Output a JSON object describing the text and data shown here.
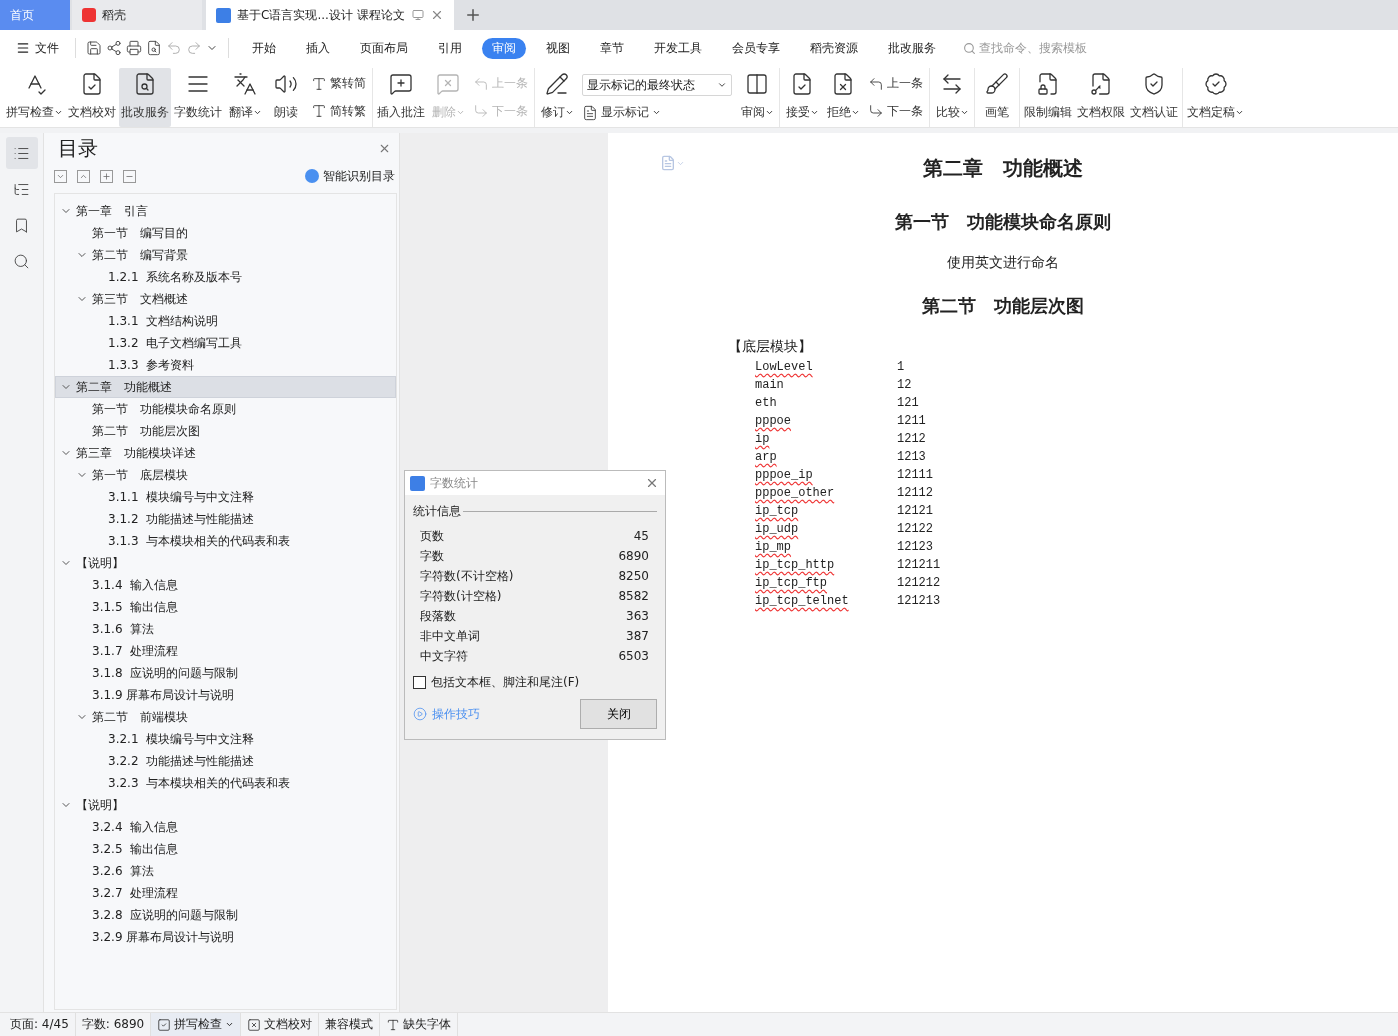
{
  "tabs": [
    {
      "label": "首页",
      "kind": "home",
      "selected": false
    },
    {
      "label": "稻壳",
      "kind": "app",
      "selected": false
    },
    {
      "label": "基于C语言实现...设计 课程论文",
      "kind": "doc",
      "selected": true
    }
  ],
  "menu": {
    "file_label": "文件",
    "tabs": [
      {
        "label": "开始",
        "selected": false
      },
      {
        "label": "插入",
        "selected": false
      },
      {
        "label": "页面布局",
        "selected": false
      },
      {
        "label": "引用",
        "selected": false
      },
      {
        "label": "审阅",
        "selected": true
      },
      {
        "label": "视图",
        "selected": false
      },
      {
        "label": "章节",
        "selected": false
      },
      {
        "label": "开发工具",
        "selected": false
      },
      {
        "label": "会员专享",
        "selected": false
      },
      {
        "label": "稻壳资源",
        "selected": false
      },
      {
        "label": "批改服务",
        "selected": false
      }
    ],
    "search_placeholder": "查找命令、搜索模板"
  },
  "ribbon": [
    {
      "items": [
        {
          "kind": "big",
          "label": "拼写检查",
          "dropdown": true,
          "disabled": false,
          "selected": false
        },
        {
          "kind": "big",
          "label": "文档校对",
          "dropdown": false,
          "disabled": false,
          "selected": false
        },
        {
          "kind": "big",
          "label": "批改服务",
          "dropdown": false,
          "disabled": false,
          "selected": true
        },
        {
          "kind": "big",
          "label": "字数统计",
          "dropdown": false,
          "disabled": false,
          "selected": false
        },
        {
          "kind": "big",
          "label": "翻译",
          "dropdown": true,
          "disabled": false,
          "selected": false
        },
        {
          "kind": "big",
          "label": "朗读",
          "dropdown": false,
          "disabled": false,
          "selected": false
        },
        {
          "kind": "stack",
          "items": [
            {
              "kind": "small",
              "label": "繁转简",
              "dropdown": false,
              "disabled": false
            },
            {
              "kind": "small",
              "label": "简转繁",
              "dropdown": false,
              "disabled": false
            }
          ]
        }
      ]
    },
    {
      "items": [
        {
          "kind": "big",
          "label": "插入批注",
          "dropdown": false,
          "disabled": false,
          "selected": false
        },
        {
          "kind": "big",
          "label": "删除",
          "dropdown": true,
          "disabled": true,
          "selected": false
        },
        {
          "kind": "stack",
          "items": [
            {
              "kind": "small",
              "label": "上一条",
              "dropdown": false,
              "disabled": true
            },
            {
              "kind": "small",
              "label": "下一条",
              "dropdown": false,
              "disabled": true
            }
          ]
        }
      ]
    },
    {
      "items": [
        {
          "kind": "big",
          "label": "修订",
          "dropdown": true,
          "disabled": false,
          "selected": false
        },
        {
          "kind": "stack",
          "items": [
            {
              "kind": "select",
              "value": "显示标记的最终状态"
            },
            {
              "kind": "small",
              "label": "显示标记",
              "dropdown": true,
              "disabled": false
            }
          ]
        },
        {
          "kind": "big",
          "label": "审阅",
          "dropdown": true,
          "disabled": false,
          "selected": false
        }
      ]
    },
    {
      "items": [
        {
          "kind": "big",
          "label": "接受",
          "dropdown": true,
          "disabled": false,
          "selected": false
        },
        {
          "kind": "big",
          "label": "拒绝",
          "dropdown": true,
          "disabled": false,
          "selected": false
        },
        {
          "kind": "stack",
          "items": [
            {
              "kind": "small",
              "label": "上一条",
              "dropdown": false,
              "disabled": false
            },
            {
              "kind": "small",
              "label": "下一条",
              "dropdown": false,
              "disabled": false
            }
          ]
        }
      ]
    },
    {
      "items": [
        {
          "kind": "big",
          "label": "比较",
          "dropdown": true,
          "disabled": false,
          "selected": false
        }
      ]
    },
    {
      "items": [
        {
          "kind": "big",
          "label": "画笔",
          "dropdown": false,
          "disabled": false,
          "selected": false
        }
      ]
    },
    {
      "items": [
        {
          "kind": "big",
          "label": "限制编辑",
          "dropdown": false,
          "disabled": false,
          "selected": false
        },
        {
          "kind": "big",
          "label": "文档权限",
          "dropdown": false,
          "disabled": false,
          "selected": false
        },
        {
          "kind": "big",
          "label": "文档认证",
          "dropdown": false,
          "disabled": false,
          "selected": false
        }
      ]
    },
    {
      "items": [
        {
          "kind": "big",
          "label": "文档定稿",
          "dropdown": true,
          "disabled": false,
          "selected": false
        }
      ]
    }
  ],
  "rail": [
    {
      "selected": true
    },
    {
      "selected": false
    },
    {
      "selected": false
    },
    {
      "selected": false
    }
  ],
  "toc": {
    "title": "目录",
    "smart_label": "智能识别目录",
    "items": [
      {
        "label": "第一章　引言",
        "expanded": true,
        "selected": false,
        "children": [
          {
            "label": "第一节　编写目的",
            "selected": false
          },
          {
            "label": "第二节　编写背景",
            "expanded": true,
            "selected": false,
            "children": [
              {
                "label": "1.2.1  系统名称及版本号",
                "selected": false
              }
            ]
          },
          {
            "label": "第三节　文档概述",
            "expanded": true,
            "selected": false,
            "children": [
              {
                "label": "1.3.1  文档结构说明",
                "selected": false
              },
              {
                "label": "1.3.2  电子文档编写工具",
                "selected": false
              },
              {
                "label": "1.3.3  参考资料",
                "selected": false
              }
            ]
          }
        ]
      },
      {
        "label": "第二章　功能概述",
        "expanded": true,
        "selected": true,
        "children": [
          {
            "label": "第一节　功能模块命名原则",
            "selected": false
          },
          {
            "label": "第二节　功能层次图",
            "selected": false
          }
        ]
      },
      {
        "label": "第三章　功能模块详述",
        "expanded": true,
        "selected": false,
        "children": [
          {
            "label": "第一节　底层模块",
            "expanded": true,
            "selected": false,
            "children": [
              {
                "label": "3.1.1  模块编号与中文注释",
                "selected": false
              },
              {
                "label": "3.1.2  功能描述与性能描述",
                "selected": false
              },
              {
                "label": "3.1.3  与本模块相关的代码表和表",
                "selected": false
              }
            ]
          }
        ]
      },
      {
        "label": "【说明】",
        "expanded": true,
        "selected": false,
        "children": [
          {
            "label": "3.1.4  输入信息",
            "selected": false
          },
          {
            "label": "3.1.5  输出信息",
            "selected": false
          },
          {
            "label": "3.1.6  算法",
            "selected": false
          },
          {
            "label": "3.1.7  处理流程",
            "selected": false
          },
          {
            "label": "3.1.8  应说明的问题与限制",
            "selected": false
          },
          {
            "label": "3.1.9 屏幕布局设计与说明",
            "selected": false
          },
          {
            "label": "第二节　前端模块",
            "expanded": true,
            "selected": false,
            "children": [
              {
                "label": "3.2.1  模块编号与中文注释",
                "selected": false
              },
              {
                "label": "3.2.2  功能描述与性能描述",
                "selected": false
              },
              {
                "label": "3.2.3  与本模块相关的代码表和表",
                "selected": false
              }
            ]
          }
        ]
      },
      {
        "label": "【说明】",
        "expanded": true,
        "selected": false,
        "children": [
          {
            "label": "3.2.4  输入信息",
            "selected": false
          },
          {
            "label": "3.2.5  输出信息",
            "selected": false
          },
          {
            "label": "3.2.6  算法",
            "selected": false
          },
          {
            "label": "3.2.7  处理流程",
            "selected": false
          },
          {
            "label": "3.2.8  应说明的问题与限制",
            "selected": false
          },
          {
            "label": "3.2.9 屏幕布局设计与说明",
            "selected": false
          }
        ]
      }
    ]
  },
  "document": {
    "blocks": [
      {
        "kind": "h1",
        "text": "第二章　功能概述"
      },
      {
        "kind": "h2",
        "text": "第一节　功能模块命名原则"
      },
      {
        "kind": "p",
        "text": "使用英文进行命名"
      },
      {
        "kind": "h2",
        "text": "第二节　功能层次图"
      },
      {
        "kind": "label",
        "text": "【底层模块】"
      }
    ],
    "modules": [
      {
        "name": "LowLevel",
        "code": "1",
        "misspelled": true
      },
      {
        "name": "main",
        "code": "12",
        "misspelled": false
      },
      {
        "name": "eth",
        "code": "121",
        "misspelled": false
      },
      {
        "name": "pppoe",
        "code": "1211",
        "misspelled": true
      },
      {
        "name": "ip",
        "code": "1212",
        "misspelled": true
      },
      {
        "name": "arp",
        "code": "1213",
        "misspelled": true
      },
      {
        "name": "pppoe_ip",
        "code": "12111",
        "misspelled": true
      },
      {
        "name": "pppoe_other",
        "code": "12112",
        "misspelled": true
      },
      {
        "name": "ip_tcp",
        "code": "12121",
        "misspelled": true
      },
      {
        "name": "ip_udp",
        "code": "12122",
        "misspelled": true
      },
      {
        "name": "ip_mp",
        "code": "12123",
        "misspelled": true
      },
      {
        "name": "ip_tcp_http",
        "code": "121211",
        "misspelled": true
      },
      {
        "name": "ip_tcp_ftp",
        "code": "121212",
        "misspelled": true
      },
      {
        "name": "ip_tcp_telnet",
        "code": "121213",
        "misspelled": true
      }
    ]
  },
  "dialog": {
    "title": "字数统计",
    "section": "统计信息",
    "stats": [
      {
        "label": "页数",
        "value": "45"
      },
      {
        "label": "字数",
        "value": "6890"
      },
      {
        "label": "字符数(不计空格)",
        "value": "8250"
      },
      {
        "label": "字符数(计空格)",
        "value": "8582"
      },
      {
        "label": "段落数",
        "value": "363"
      },
      {
        "label": "非中文单词",
        "value": "387"
      },
      {
        "label": "中文字符",
        "value": "6503"
      }
    ],
    "checkbox": {
      "label": "包括文本框、脚注和尾注(F)",
      "checked": false
    },
    "tips_link": "操作技巧",
    "close_button": "关闭"
  },
  "status_bar": {
    "page": "页面: 4/45",
    "words": "字数: 6890",
    "spell_check": "拼写检查",
    "proofread": "文档校对",
    "compat": "兼容模式",
    "missing_fonts": "缺失字体"
  }
}
